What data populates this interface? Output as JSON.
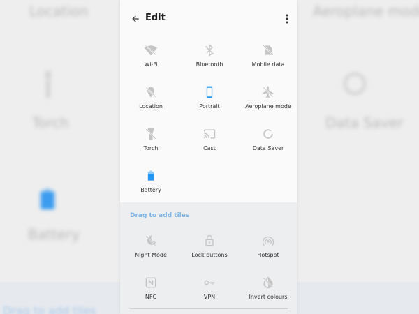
{
  "header": {
    "title": "Edit"
  },
  "active_tiles": [
    {
      "label": "Wi-Fi",
      "icon": "wifi-off-icon"
    },
    {
      "label": "Bluetooth",
      "icon": "bluetooth-off-icon"
    },
    {
      "label": "Mobile data",
      "icon": "mobile-data-off-icon"
    },
    {
      "label": "Location",
      "icon": "location-off-icon"
    },
    {
      "label": "Portrait",
      "icon": "portrait-icon"
    },
    {
      "label": "Aeroplane mode",
      "icon": "airplane-icon"
    },
    {
      "label": "Torch",
      "icon": "torch-icon"
    },
    {
      "label": "Cast",
      "icon": "cast-icon"
    },
    {
      "label": "Data Saver",
      "icon": "data-saver-icon"
    },
    {
      "label": "Battery",
      "icon": "battery-icon"
    }
  ],
  "drag_section": {
    "title": "Drag to add tiles"
  },
  "available_tiles": [
    {
      "label": "Night Mode",
      "icon": "night-mode-icon"
    },
    {
      "label": "Lock buttons",
      "icon": "lock-icon"
    },
    {
      "label": "Hotspot",
      "icon": "hotspot-icon"
    },
    {
      "label": "NFC",
      "icon": "nfc-icon"
    },
    {
      "label": "VPN",
      "icon": "vpn-key-icon"
    },
    {
      "label": "Invert colours",
      "icon": "invert-colours-icon"
    }
  ],
  "background": {
    "labels": [
      "Location",
      "Aeroplane mode",
      "Torch",
      "Data Saver",
      "Battery",
      "Drag to add tiles"
    ]
  },
  "colors": {
    "accent": "#2196f3",
    "icon_grey": "#bdbdbd",
    "drag_title": "#7fb3e4"
  }
}
